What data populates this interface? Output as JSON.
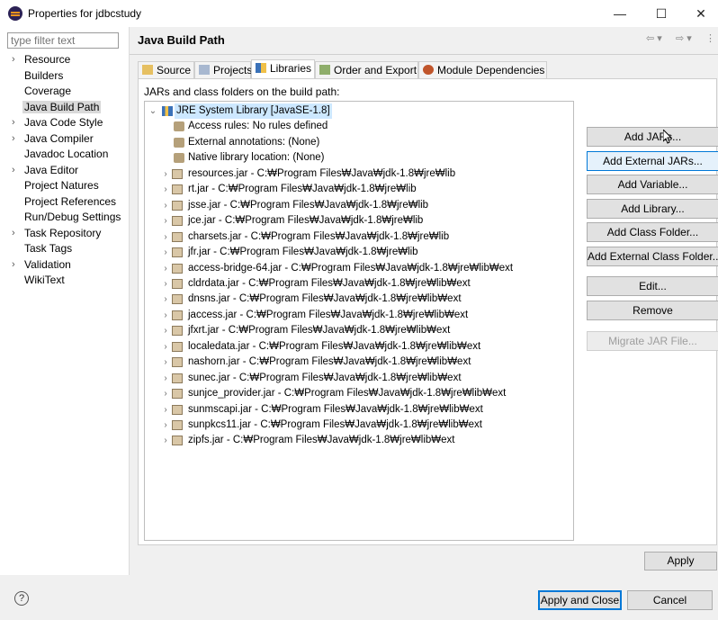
{
  "window": {
    "title": "Properties for jdbcstudy",
    "minimize": "—",
    "maximize": "☐",
    "close": "✕"
  },
  "sidebar": {
    "filter_placeholder": "type filter text",
    "items": [
      {
        "label": "Resource",
        "expandable": true
      },
      {
        "label": "Builders",
        "expandable": false
      },
      {
        "label": "Coverage",
        "expandable": false
      },
      {
        "label": "Java Build Path",
        "expandable": false,
        "selected": true
      },
      {
        "label": "Java Code Style",
        "expandable": true
      },
      {
        "label": "Java Compiler",
        "expandable": true
      },
      {
        "label": "Javadoc Location",
        "expandable": false
      },
      {
        "label": "Java Editor",
        "expandable": true
      },
      {
        "label": "Project Natures",
        "expandable": false
      },
      {
        "label": "Project References",
        "expandable": false
      },
      {
        "label": "Run/Debug Settings",
        "expandable": false
      },
      {
        "label": "Task Repository",
        "expandable": true
      },
      {
        "label": "Task Tags",
        "expandable": false
      },
      {
        "label": "Validation",
        "expandable": true
      },
      {
        "label": "WikiText",
        "expandable": false
      }
    ]
  },
  "main": {
    "title": "Java Build Path",
    "history": {
      "back": "⇦ ▾",
      "forward": "⇨ ▾",
      "menu": "⋮"
    },
    "tabs": [
      {
        "label": "Source"
      },
      {
        "label": "Projects"
      },
      {
        "label": "Libraries",
        "active": true
      },
      {
        "label": "Order and Export"
      },
      {
        "label": "Module Dependencies"
      }
    ],
    "description": "JARs and class folders on the build path:",
    "tree": {
      "root": "JRE System Library [JavaSE-1.8]",
      "root_children": [
        "Access rules: No rules defined",
        "External annotations: (None)",
        "Native library location: (None)"
      ],
      "jars": [
        "resources.jar - C:₩Program Files₩Java₩jdk-1.8₩jre₩lib",
        "rt.jar - C:₩Program Files₩Java₩jdk-1.8₩jre₩lib",
        "jsse.jar - C:₩Program Files₩Java₩jdk-1.8₩jre₩lib",
        "jce.jar - C:₩Program Files₩Java₩jdk-1.8₩jre₩lib",
        "charsets.jar - C:₩Program Files₩Java₩jdk-1.8₩jre₩lib",
        "jfr.jar - C:₩Program Files₩Java₩jdk-1.8₩jre₩lib",
        "access-bridge-64.jar - C:₩Program Files₩Java₩jdk-1.8₩jre₩lib₩ext",
        "cldrdata.jar - C:₩Program Files₩Java₩jdk-1.8₩jre₩lib₩ext",
        "dnsns.jar - C:₩Program Files₩Java₩jdk-1.8₩jre₩lib₩ext",
        "jaccess.jar - C:₩Program Files₩Java₩jdk-1.8₩jre₩lib₩ext",
        "jfxrt.jar - C:₩Program Files₩Java₩jdk-1.8₩jre₩lib₩ext",
        "localedata.jar - C:₩Program Files₩Java₩jdk-1.8₩jre₩lib₩ext",
        "nashorn.jar - C:₩Program Files₩Java₩jdk-1.8₩jre₩lib₩ext",
        "sunec.jar - C:₩Program Files₩Java₩jdk-1.8₩jre₩lib₩ext",
        "sunjce_provider.jar - C:₩Program Files₩Java₩jdk-1.8₩jre₩lib₩ext",
        "sunmscapi.jar - C:₩Program Files₩Java₩jdk-1.8₩jre₩lib₩ext",
        "sunpkcs11.jar - C:₩Program Files₩Java₩jdk-1.8₩jre₩lib₩ext",
        "zipfs.jar - C:₩Program Files₩Java₩jdk-1.8₩jre₩lib₩ext"
      ]
    },
    "buttons": {
      "add_jars": "Add JARs...",
      "add_external_jars": "Add External JARs...",
      "add_variable": "Add Variable...",
      "add_library": "Add Library...",
      "add_class_folder": "Add Class Folder...",
      "add_external_class_folder": "Add External Class Folder...",
      "edit": "Edit...",
      "remove": "Remove",
      "migrate_jar": "Migrate JAR File..."
    },
    "apply": "Apply"
  },
  "footer": {
    "help": "?",
    "apply_and_close": "Apply and Close",
    "cancel": "Cancel"
  }
}
